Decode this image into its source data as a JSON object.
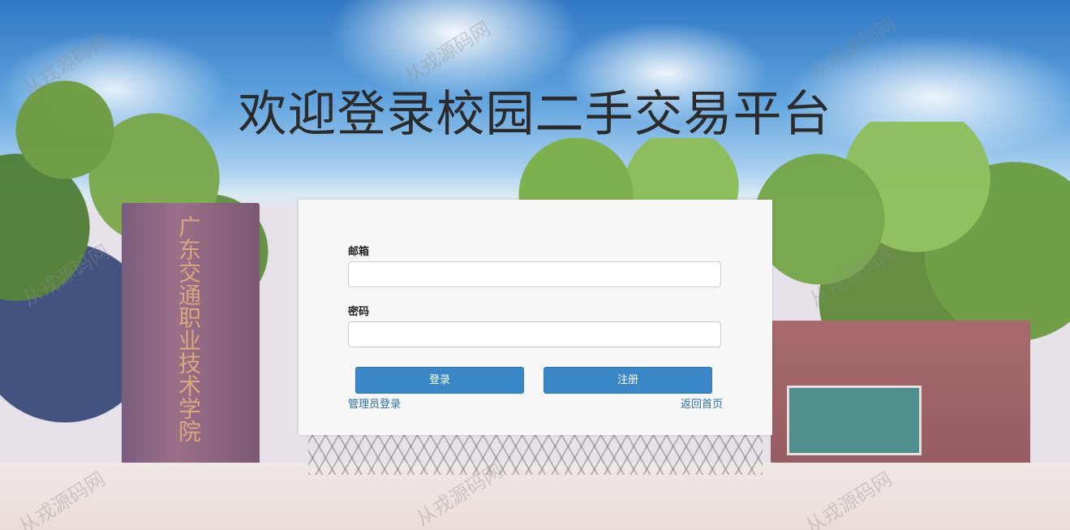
{
  "page": {
    "title": "欢迎登录校园二手交易平台"
  },
  "background": {
    "gate_inscription": "广东交通职业技术学院"
  },
  "form": {
    "email_label": "邮箱",
    "email_value": "",
    "password_label": "密码",
    "password_value": "",
    "login_button": "登录",
    "register_button": "注册",
    "admin_login_link": "管理员登录",
    "back_home_link": "返回首页"
  },
  "watermark": {
    "text": "从戎源码网"
  },
  "colors": {
    "primary_button": "#3a87c8",
    "link": "#2a6fb0",
    "panel_bg": "#f7f7f7",
    "title_text": "#2b2b2b"
  }
}
